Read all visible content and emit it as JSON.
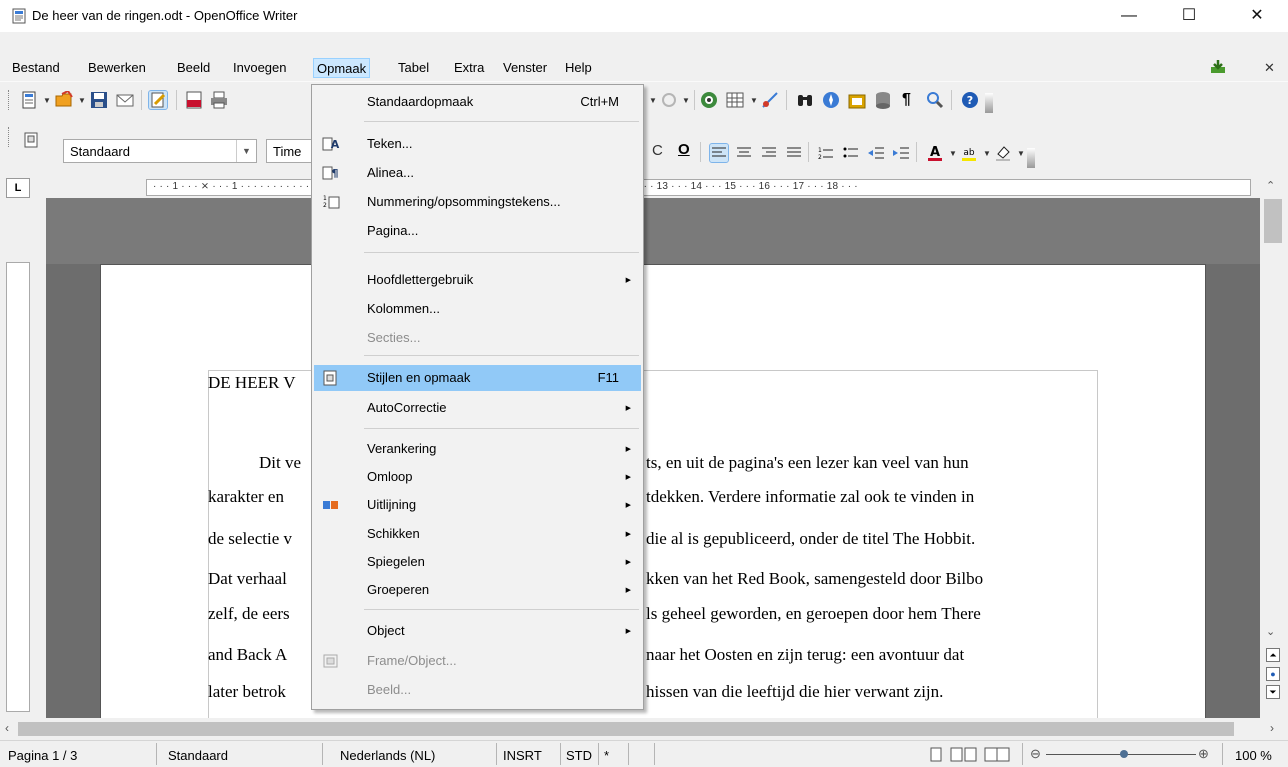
{
  "window": {
    "title": "De heer van de ringen.odt - OpenOffice Writer",
    "minimize": "—",
    "maximize": "☐",
    "close": "✕"
  },
  "menubar": {
    "items": [
      "Bestand",
      "Bewerken",
      "Beeld",
      "Invoegen",
      "Opmaak",
      "Tabel",
      "Extra",
      "Venster",
      "Help"
    ],
    "close_doc": "✕"
  },
  "format_toolbar": {
    "paragraph_style": "Standaard",
    "font_name": "Time"
  },
  "ruler": {
    "corner": "L",
    "ticks": "· · · 1 · · · ⨯ · · · 1 · · · · · · · · · · · · · · · · · · · · · · · · · · · · · · · · · · · · · · · · · · · · 9 · · · 10 · · · 11 · · · 12 · · · 13 · · · 14 · · · 15 · · · 16 · · · 17 · · · 18 · · ·"
  },
  "document": {
    "heading": "DE HEER V",
    "lines": [
      "Dit ve",
      "ts, en uit de pagina's een lezer kan veel van hun",
      "karakter en",
      "tdekken. Verdere informatie zal ook te vinden in",
      "de selectie v",
      "die al is gepubliceerd, onder de titel The Hobbit.",
      "Dat verhaal",
      "kken van het Red Book, samengesteld door Bilbo",
      "zelf, de eers",
      "ls geheel geworden, en geroepen door hem There",
      "and Back A",
      "naar het Oosten en zijn terug: een avontuur dat",
      "later betrok",
      "hissen van die leeftijd die hier verwant zijn."
    ]
  },
  "dropdown_menu": {
    "items": [
      {
        "label": "Standaardopmaak",
        "shortcut": "Ctrl+M"
      },
      {
        "label": "Teken..."
      },
      {
        "label": "Alinea..."
      },
      {
        "label": "Nummering/opsommingstekens..."
      },
      {
        "label": "Pagina..."
      },
      {
        "label": "Hoofdlettergebruik"
      },
      {
        "label": "Kolommen..."
      },
      {
        "label": "Secties..."
      },
      {
        "label": "Stijlen en opmaak",
        "shortcut": "F11"
      },
      {
        "label": "AutoCorrectie"
      },
      {
        "label": "Verankering"
      },
      {
        "label": "Omloop"
      },
      {
        "label": "Uitlijning"
      },
      {
        "label": "Schikken"
      },
      {
        "label": "Spiegelen"
      },
      {
        "label": "Groeperen"
      },
      {
        "label": "Object"
      },
      {
        "label": "Frame/Object..."
      },
      {
        "label": "Beeld..."
      }
    ]
  },
  "statusbar": {
    "page": "Pagina 1 / 3",
    "style": "Standaard",
    "language": "Nederlands (NL)",
    "insert_mode": "INSRT",
    "selection_mode": "STD",
    "modified": "*",
    "zoom": "100 %"
  }
}
